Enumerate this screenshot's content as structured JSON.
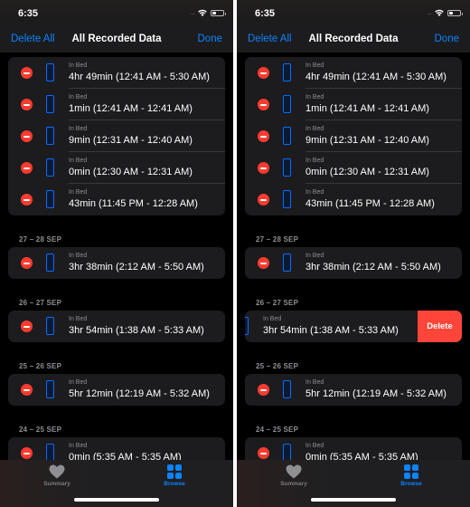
{
  "status_bar": {
    "time": "6:35",
    "signal": "....."
  },
  "nav": {
    "left_button": "Delete All",
    "title": "All Recorded Data",
    "right_button": "Done"
  },
  "groups": [
    {
      "header": "",
      "rows": [
        {
          "label": "In Bed",
          "value": "4hr 49min (12:41 AM - 5:30 AM)"
        },
        {
          "label": "In Bed",
          "value": "1min (12:41 AM - 12:41 AM)"
        },
        {
          "label": "In Bed",
          "value": "9min (12:31 AM - 12:40 AM)"
        },
        {
          "label": "In Bed",
          "value": "0min (12:30 AM - 12:31 AM)"
        },
        {
          "label": "In Bed",
          "value": "43min (11:45 PM - 12:28 AM)"
        }
      ]
    },
    {
      "header": "27 – 28 SEP",
      "rows": [
        {
          "label": "In Bed",
          "value": "3hr 38min (2:12 AM - 5:50 AM)"
        }
      ]
    },
    {
      "header": "26 – 27 SEP",
      "rows": [
        {
          "label": "In Bed",
          "value": "3hr 54min (1:38 AM - 5:33 AM)"
        }
      ]
    },
    {
      "header": "25 – 26 SEP",
      "rows": [
        {
          "label": "In Bed",
          "value": "5hr 12min (12:19 AM - 5:32 AM)"
        }
      ]
    },
    {
      "header": "24 – 25 SEP",
      "rows": [
        {
          "label": "In Bed",
          "value": "0min (5:35 AM - 5:35 AM)"
        }
      ]
    }
  ],
  "swipe": {
    "delete_label": "Delete"
  },
  "tabbar": {
    "tabs": [
      {
        "label": "Summary",
        "icon": "heart-icon",
        "active": false
      },
      {
        "label": "Browse",
        "icon": "grid-icon",
        "active": true
      }
    ]
  },
  "colors": {
    "accent": "#0a84ff",
    "destructive": "#ff3b30",
    "background": "#000000",
    "cell": "#1c1c1e"
  }
}
